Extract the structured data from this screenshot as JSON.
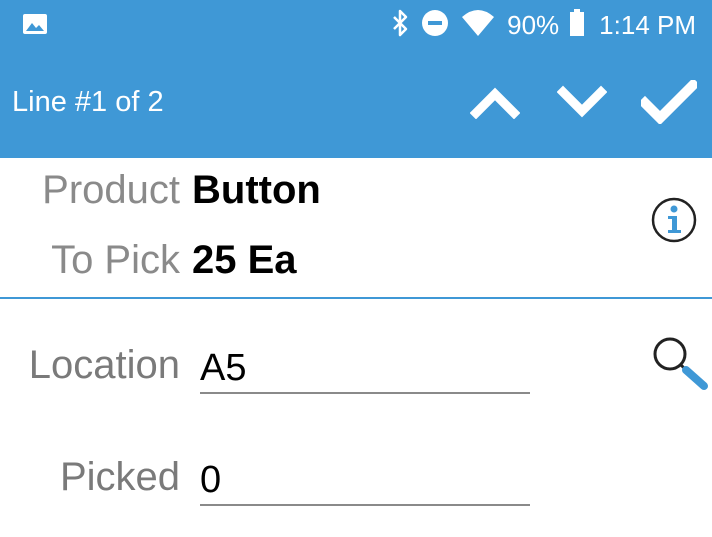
{
  "status_bar": {
    "left_icons": [
      "image-icon"
    ],
    "right_icons": [
      "bluetooth-icon",
      "do-not-disturb-icon",
      "wifi-icon"
    ],
    "battery": "90%",
    "time": "1:14 PM"
  },
  "toolbar": {
    "title": "Line #1 of 2",
    "actions": [
      "chevron-up-icon",
      "chevron-down-icon",
      "check-icon"
    ],
    "background": "#3f98d6"
  },
  "product": {
    "product_label": "Product",
    "product_value": "Button",
    "topick_label": "To Pick",
    "topick_value": "25 Ea"
  },
  "form": {
    "location_label": "Location",
    "location_value": "A5",
    "picked_label": "Picked",
    "picked_value": "0"
  },
  "colors": {
    "accent": "#3f98d6",
    "label_gray": "#8a8a8a"
  }
}
